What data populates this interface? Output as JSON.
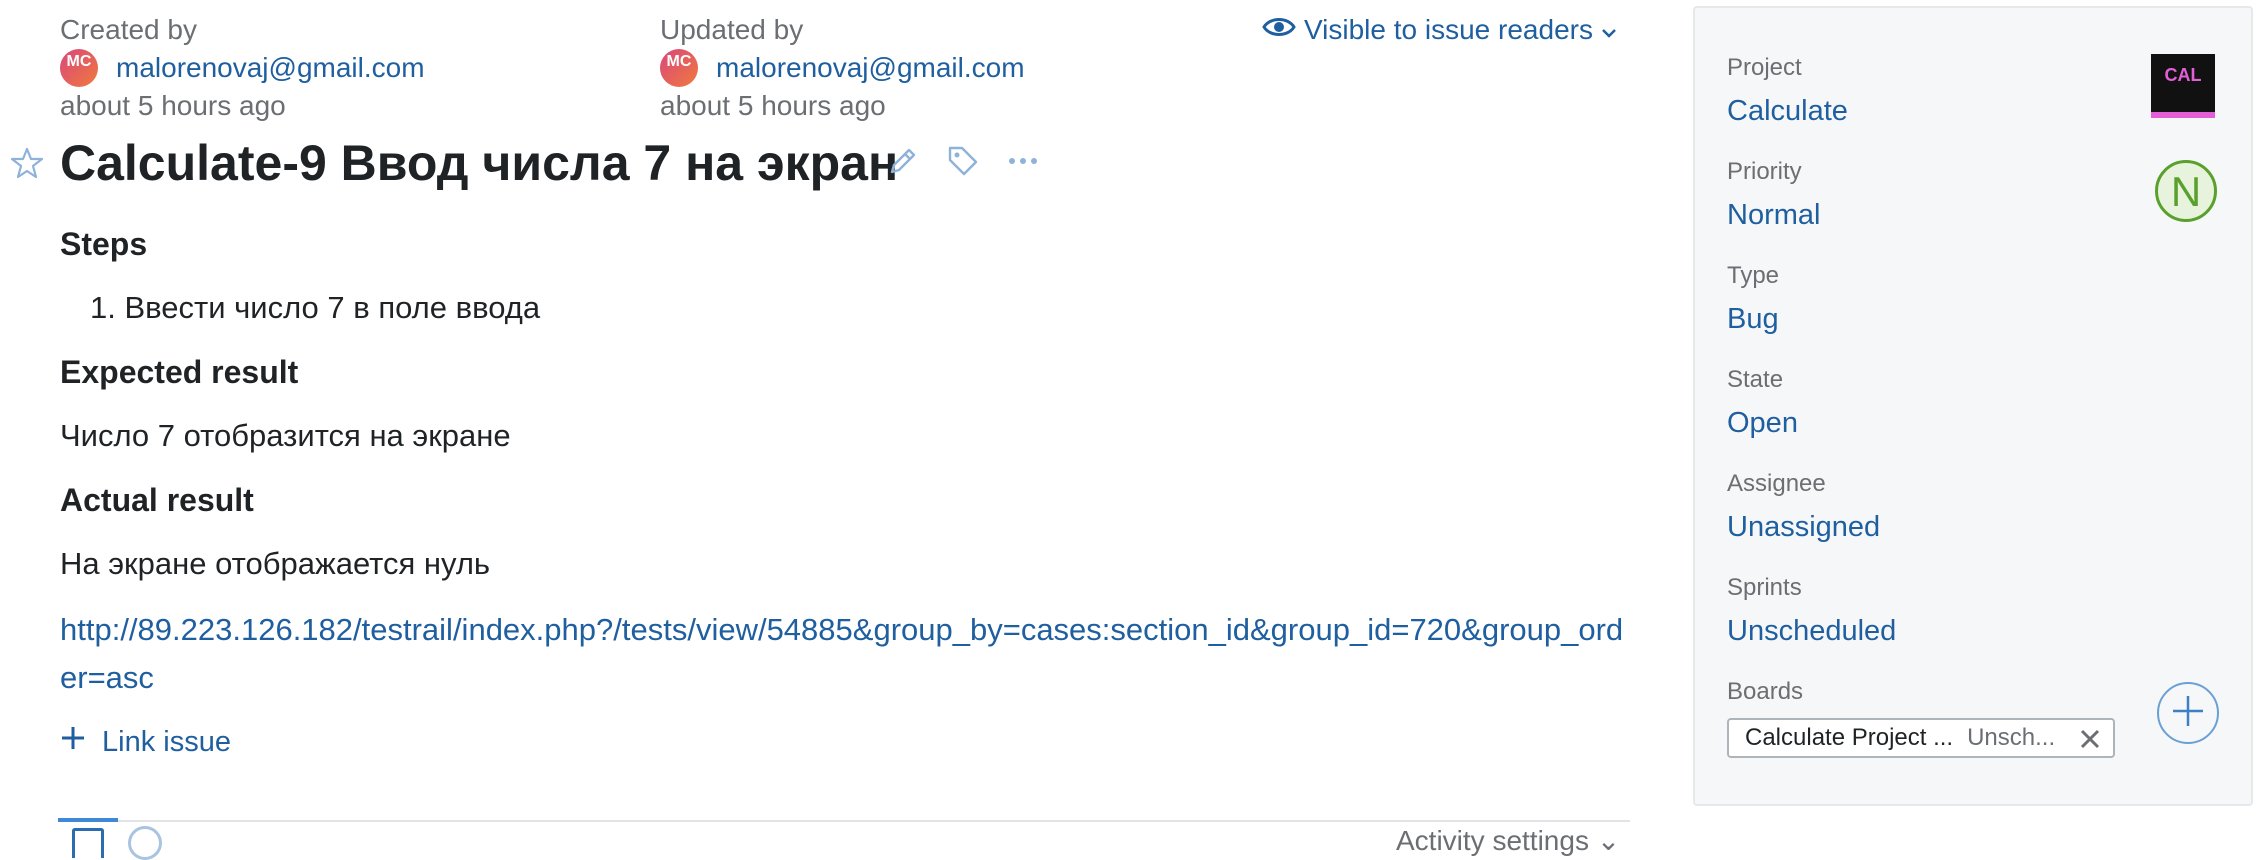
{
  "header": {
    "created_label": "Created by",
    "created_avatar": "MC",
    "created_user": "malorenovaj@gmail.com",
    "created_time": "about 5 hours ago",
    "updated_label": "Updated by",
    "updated_avatar": "MC",
    "updated_user": "malorenovaj@gmail.com",
    "updated_time": "about 5 hours ago",
    "visibility": "Visible to issue readers"
  },
  "issue": {
    "title": "Calculate-9 Ввод числа 7 на экран",
    "steps_heading": "Steps",
    "steps": [
      "1. Ввести число 7 в поле ввода"
    ],
    "expected_heading": "Expected result",
    "expected": "Число 7 отобразится на экране",
    "actual_heading": "Actual result",
    "actual": "На экране отображается нуль",
    "url": "http://89.223.126.182/testrail/index.php?/tests/view/54885&group_by=cases:section_id&group_id=720&group_order=asc",
    "link_issue": "Link issue"
  },
  "tabs": {
    "activity_settings": "Activity settings"
  },
  "sidebar": {
    "project_label": "Project",
    "project_value": "Calculate",
    "project_badge": "CAL",
    "priority_label": "Priority",
    "priority_value": "Normal",
    "priority_badge": "N",
    "type_label": "Type",
    "type_value": "Bug",
    "state_label": "State",
    "state_value": "Open",
    "assignee_label": "Assignee",
    "assignee_value": "Unassigned",
    "sprints_label": "Sprints",
    "sprints_value": "Unscheduled",
    "boards_label": "Boards",
    "board_name": "Calculate Project ...",
    "board_state": "Unsch..."
  },
  "colors": {
    "link": "#1f5fa0",
    "muted": "#6b6f73",
    "priority_green": "#5aa02c",
    "project_pink": "#e25fd6"
  },
  "icons": [
    "eye-icon",
    "chevron-down-icon",
    "star-icon",
    "pencil-icon",
    "tag-icon",
    "more-icon",
    "plus-icon",
    "close-icon"
  ]
}
